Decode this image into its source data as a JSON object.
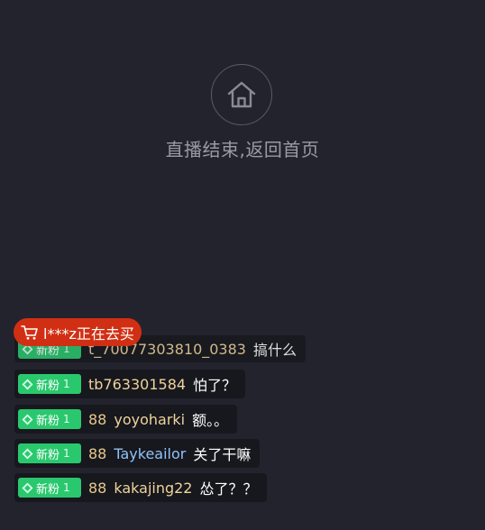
{
  "end_screen": {
    "icon": "home-icon",
    "message": "直播结束,返回首页"
  },
  "buying_notice": {
    "icon": "shopping-cart-icon",
    "text": "l***z正在去买"
  },
  "chat": {
    "partial_row": {
      "username": "t_70077303810_0383",
      "message": "搞什么"
    },
    "rows": [
      {
        "badge_label": "新粉",
        "badge_level": "1",
        "level": "",
        "username": "tb763301584",
        "message": "怕了？",
        "name_color": "gold"
      },
      {
        "badge_label": "新粉",
        "badge_level": "1",
        "level": "88",
        "username": "yoyoharki",
        "message": "额。。",
        "name_color": "gold"
      },
      {
        "badge_label": "新粉",
        "badge_level": "1",
        "level": "88",
        "username": "Taykeailor",
        "message": "关了干嘛",
        "name_color": "blue"
      },
      {
        "badge_label": "新粉",
        "badge_level": "1",
        "level": "88",
        "username": "kakajing22",
        "message": "怂了？？",
        "name_color": "gold"
      }
    ]
  },
  "colors": {
    "background": "#23232e",
    "badge_green": "#2ac86e",
    "buy_red": "#d12f14",
    "name_gold": "#eed49a",
    "name_blue": "#8fc4f5"
  }
}
